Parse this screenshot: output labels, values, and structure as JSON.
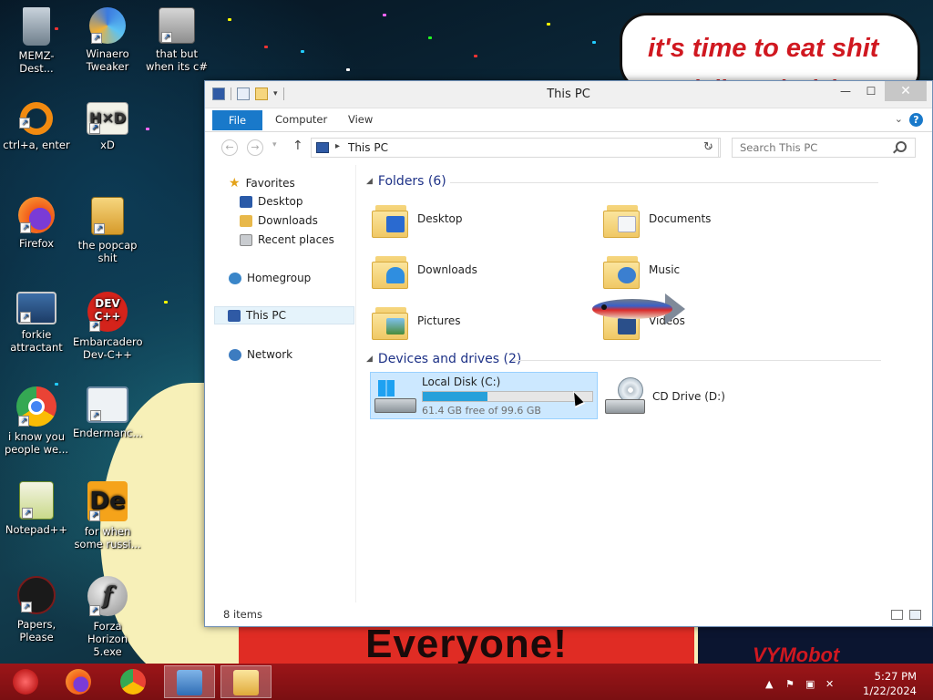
{
  "desktop": {
    "icons": [
      {
        "label": "MEMZ-Dest...",
        "icon": "recycle-bin-icon"
      },
      {
        "label": "Winaero Tweaker",
        "icon": "winaero-icon"
      },
      {
        "label": "that but when its c#",
        "icon": "windows-stack-icon"
      },
      {
        "label": "ctrl+a, enter",
        "icon": "orange-ring-icon"
      },
      {
        "label": "xD",
        "icon": "hxd-icon"
      },
      {
        "label": "Firefox",
        "icon": "firefox-icon"
      },
      {
        "label": "the popcap shit",
        "icon": "popcap-icon"
      },
      {
        "label": "forkie attractant",
        "icon": "settings-monitor-icon"
      },
      {
        "label": "Embarcadero Dev-C++",
        "icon": "devcpp-icon"
      },
      {
        "label": "i know you people we...",
        "icon": "chrome-icon"
      },
      {
        "label": "Endermanc...",
        "icon": "window-icon"
      },
      {
        "label": "Notepad++",
        "icon": "notepadpp-icon"
      },
      {
        "label": "for when some russi...",
        "icon": "de-icon"
      },
      {
        "label": "Papers, Please",
        "icon": "papers-please-icon"
      },
      {
        "label": "Forza Horizon 5.exe",
        "icon": "flash-icon"
      }
    ],
    "wallpaper_text": {
      "bubble_line1": "it's time to eat shit",
      "bubble_line2": "and die endcelebrate",
      "banner": "Everyone!",
      "sign": "VYMobot"
    }
  },
  "window": {
    "title": "This PC",
    "controls": {
      "minimize": "—",
      "maximize": "☐",
      "close": "✕"
    },
    "ribbon": {
      "tabs": [
        "File",
        "Computer",
        "View"
      ],
      "help": "?"
    },
    "address": {
      "path": "This PC",
      "search_placeholder": "Search This PC"
    },
    "nav": {
      "favorites": "Favorites",
      "favorites_items": [
        "Desktop",
        "Downloads",
        "Recent places"
      ],
      "homegroup": "Homegroup",
      "this_pc": "This PC",
      "network": "Network"
    },
    "folders_header": "Folders (6)",
    "folders": [
      {
        "name": "Desktop",
        "icon": "desktop-folder-icon"
      },
      {
        "name": "Documents",
        "icon": "documents-folder-icon"
      },
      {
        "name": "Downloads",
        "icon": "downloads-folder-icon"
      },
      {
        "name": "Music",
        "icon": "music-folder-icon"
      },
      {
        "name": "Pictures",
        "icon": "pictures-folder-icon"
      },
      {
        "name": "Videos",
        "icon": "videos-folder-icon"
      }
    ],
    "devices_header": "Devices and drives (2)",
    "drives": [
      {
        "name": "Local Disk (C:)",
        "free": "61.4 GB free of 99.6 GB",
        "used_fraction": 0.384,
        "icon": "hard-drive-icon"
      },
      {
        "name": "CD Drive (D:)",
        "icon": "cd-drive-icon"
      }
    ],
    "status": "8 items"
  },
  "taskbar": {
    "items": [
      "start-orb-icon",
      "firefox-icon",
      "chrome-icon",
      "control-panel-icon",
      "file-explorer-icon"
    ],
    "time": "5:27 PM",
    "date": "1/22/2024"
  },
  "colors": {
    "accent": "#1979ca",
    "taskbar": "#8b1215",
    "selection": "#cce8ff"
  }
}
